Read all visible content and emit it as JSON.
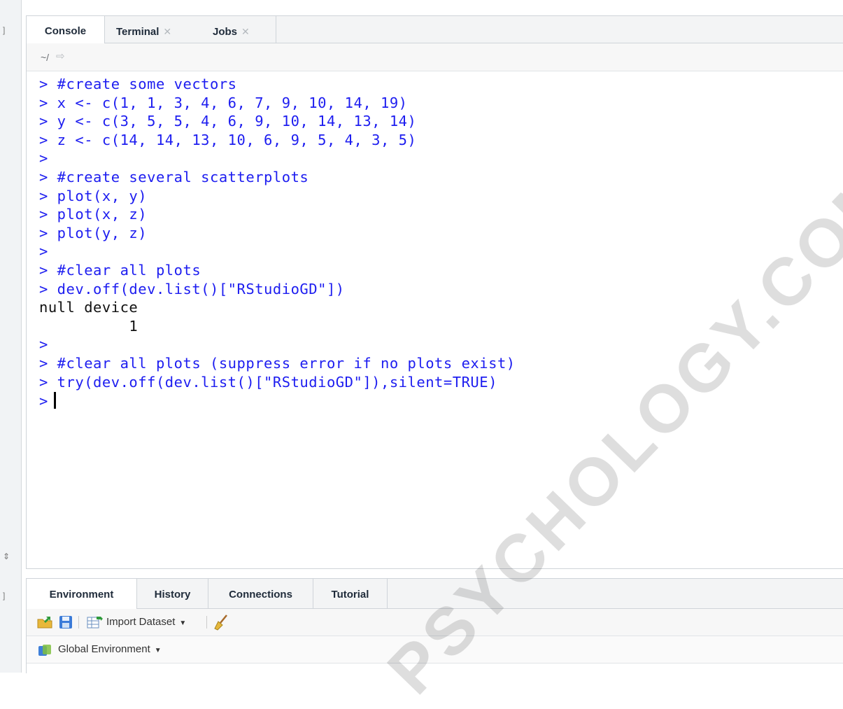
{
  "console_pane": {
    "tabs": [
      {
        "label": "Console",
        "closable": false,
        "active": true
      },
      {
        "label": "Terminal",
        "closable": true,
        "active": false
      },
      {
        "label": "Jobs",
        "closable": true,
        "active": false
      }
    ],
    "path": "~/",
    "lines": [
      {
        "text": "> #create some vectors",
        "kind": "input"
      },
      {
        "text": "> x <- c(1, 1, 3, 4, 6, 7, 9, 10, 14, 19)",
        "kind": "input"
      },
      {
        "text": "> y <- c(3, 5, 5, 4, 6, 9, 10, 14, 13, 14)",
        "kind": "input"
      },
      {
        "text": "> z <- c(14, 14, 13, 10, 6, 9, 5, 4, 3, 5)",
        "kind": "input"
      },
      {
        "text": ">",
        "kind": "input"
      },
      {
        "text": "> #create several scatterplots",
        "kind": "input"
      },
      {
        "text": "> plot(x, y)",
        "kind": "input"
      },
      {
        "text": "> plot(x, z)",
        "kind": "input"
      },
      {
        "text": "> plot(y, z)",
        "kind": "input"
      },
      {
        "text": ">",
        "kind": "input"
      },
      {
        "text": "> #clear all plots",
        "kind": "input"
      },
      {
        "text": "> dev.off(dev.list()[\"RStudioGD\"])",
        "kind": "input"
      },
      {
        "text": "null device",
        "kind": "output"
      },
      {
        "text": "          1",
        "kind": "output"
      },
      {
        "text": ">",
        "kind": "input"
      },
      {
        "text": "> #clear all plots (suppress error if no plots exist)",
        "kind": "input"
      },
      {
        "text": "> try(dev.off(dev.list()[\"RStudioGD\"]),silent=TRUE)",
        "kind": "input"
      }
    ],
    "prompt": ">"
  },
  "env_pane": {
    "tabs": [
      {
        "label": "Environment",
        "active": true
      },
      {
        "label": "History",
        "active": false
      },
      {
        "label": "Connections",
        "active": false
      },
      {
        "label": "Tutorial",
        "active": false
      }
    ],
    "toolbar": {
      "import_label": "Import Dataset"
    },
    "environment_label": "Global Environment"
  },
  "watermark": "PSYCHOLOGY.COM",
  "colors": {
    "input": "#1d1df0",
    "output": "#111111"
  }
}
